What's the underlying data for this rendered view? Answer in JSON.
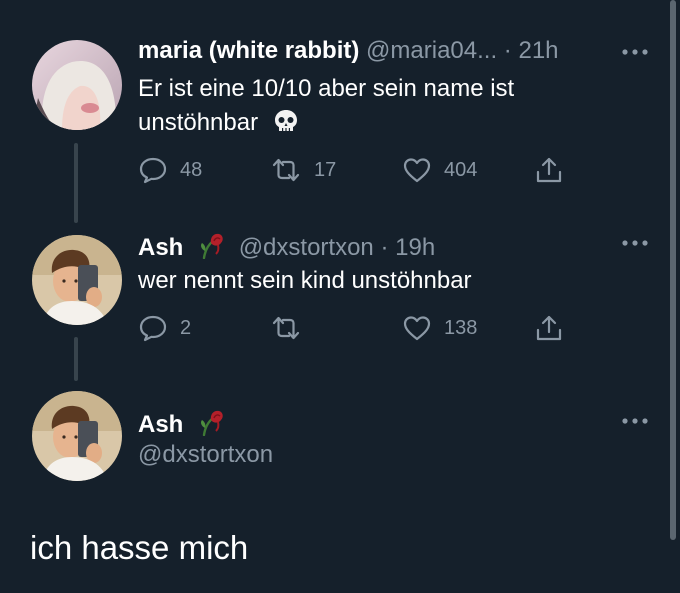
{
  "tweets": [
    {
      "name": "maria (white rabbit)",
      "handle": "@maria04...",
      "separator": "·",
      "time": "21h",
      "text_line1": "Er ist eine 10/10 aber sein name ist",
      "text_line2": "unstöhnbar",
      "text_emoji": "skull-icon",
      "replies": "48",
      "retweets": "17",
      "likes": "404"
    },
    {
      "name": "Ash",
      "name_emoji": "wilted-rose-icon",
      "handle": "@dxstortxon",
      "separator": "·",
      "time": "19h",
      "text": "wer nennt sein kind unstöhnbar",
      "replies": "2",
      "retweets": "",
      "likes": "138"
    }
  ],
  "focused": {
    "name": "Ash",
    "name_emoji": "wilted-rose-icon",
    "handle": "@dxstortxon",
    "text": "ich hasse mich"
  },
  "colors": {
    "background": "#15202b",
    "text": "#ffffff",
    "secondary": "#8b98a5",
    "thread_line": "#38444d"
  }
}
